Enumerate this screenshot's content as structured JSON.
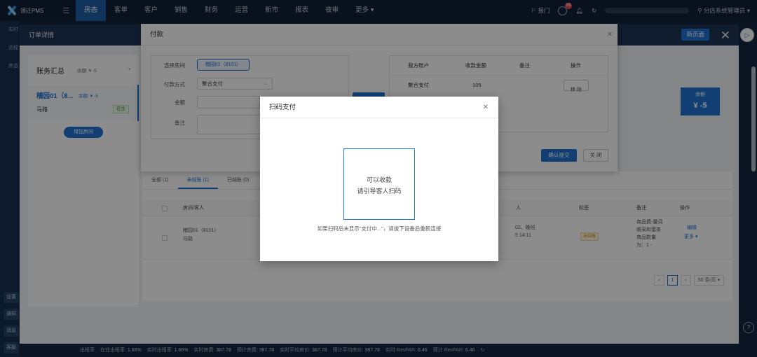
{
  "app": {
    "logo_text": "领迁PMS"
  },
  "topnav": {
    "items": [
      {
        "label": "房态",
        "active": true
      },
      {
        "label": "客单",
        "active": false
      },
      {
        "label": "客户",
        "active": false
      },
      {
        "label": "销售",
        "active": false
      },
      {
        "label": "财务",
        "active": false
      },
      {
        "label": "运营",
        "active": false
      },
      {
        "label": "新市",
        "active": false
      },
      {
        "label": "报表",
        "active": false
      },
      {
        "label": "夜审",
        "active": false
      },
      {
        "label": "更多 ▾",
        "active": false
      }
    ],
    "right": {
      "report_label": "报门",
      "badge_count": "99",
      "user_label": "分店系统管理员 ▾"
    }
  },
  "sidebar": {
    "items": [
      "实时",
      "远程",
      "房态"
    ],
    "bottom_items": [
      "设置",
      "通知",
      "消息",
      "客服"
    ]
  },
  "order_panel": {
    "title": "订单详情",
    "new_page_button": "新页面",
    "summary": {
      "title": "账务汇总",
      "remaining": "余额: ¥ -5",
      "room_name": "稽园01（8...",
      "room_balance": "余额: ¥ -5",
      "guest": "马路",
      "status_tag": "在住",
      "add_room_button": "增加房间"
    },
    "balance_card": {
      "label": "余额",
      "value": "¥ -5"
    },
    "tabs": [
      {
        "label": "全部 (1)",
        "active": false
      },
      {
        "label": "未结账 (1)",
        "active": true
      },
      {
        "label": "已结账 (0)",
        "active": false
      }
    ],
    "table": {
      "headers": {
        "room_guest": "房间/客人",
        "col_unit": "人",
        "tag": "标签",
        "note": "备注",
        "action": "操作"
      },
      "row": {
        "room": "稽园01（8101）",
        "guest": "马路",
        "col_unit_l1": "02、晚班",
        "col_unit_l2": "5 14:11",
        "tag": "未结账",
        "note_l1": "商品费-量词",
        "note_l2": "维采和蛋茶",
        "note_l3": "商品数量",
        "note_l4": "为：1 -",
        "action_edit": "编辑",
        "action_more": "更多 ▾"
      }
    },
    "pager": {
      "prev": "‹",
      "current": "1",
      "next": "›",
      "page_size": "50 条/页 ▾"
    }
  },
  "pay_dialog": {
    "title": "付款",
    "form": {
      "room_label": "选择房间",
      "room_value": "稽园01（8101）",
      "method_label": "付款方式",
      "method_value": "聚合支付",
      "amount_label": "金额",
      "note_label": "备注"
    },
    "table": {
      "headers": [
        "我方账户",
        "收款金额",
        "备注",
        "操作"
      ],
      "row": {
        "account": "聚合支付",
        "amount": "105",
        "note": "",
        "action": "移 除"
      }
    },
    "submit_button": "确认提交",
    "close_button": "关 闭"
  },
  "scan_dialog": {
    "title": "扫码支付",
    "qr_line1": "可以收款",
    "qr_line2": "请引导客人扫码",
    "tip": "如果扫码后未显示\"支付中...\"，请拔下设备后重新连接"
  },
  "status_bar": {
    "items": [
      {
        "label": "出租率",
        "value": ""
      },
      {
        "label": "在住出租率:",
        "value": "1.66%"
      },
      {
        "label": "实时出租率:",
        "value": "1.66%"
      },
      {
        "label": "实时房费:",
        "value": "387.78"
      },
      {
        "label": "预计房费:",
        "value": "387.78"
      },
      {
        "label": "实时平均房价:",
        "value": "387.78"
      },
      {
        "label": "预计平均房价:",
        "value": "387.78"
      },
      {
        "label": "实时 RevPAR:",
        "value": "6.46"
      },
      {
        "label": "预计 RevPAR:",
        "value": "6.46"
      }
    ]
  },
  "colors": {
    "accent": "#1f74d3",
    "nav_bg": "#0f1f36",
    "active_nav": "#1f5fa8"
  }
}
